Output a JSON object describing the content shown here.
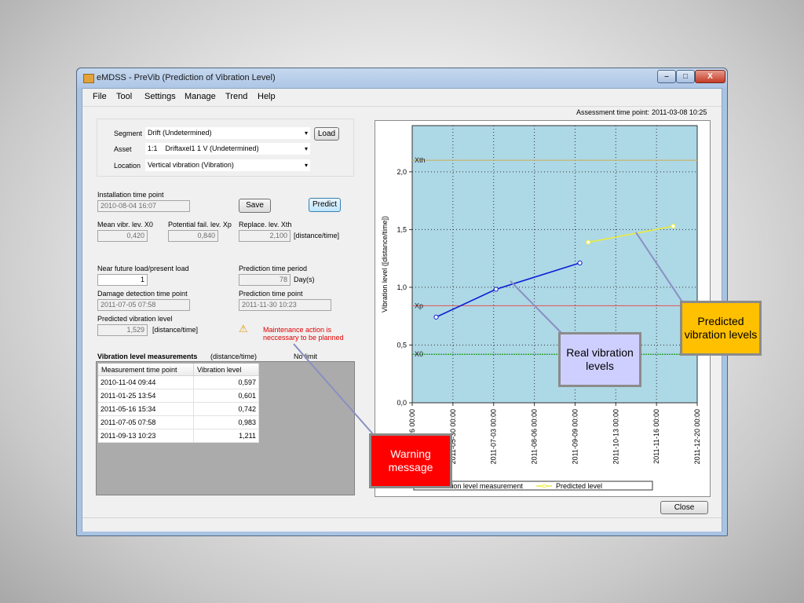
{
  "window": {
    "title": "eMDSS - PreVib (Prediction of Vibration Level)",
    "min": "–",
    "max": "□",
    "close": "X"
  },
  "menu": [
    "File",
    "Tool",
    "Settings",
    "Manage",
    "Trend",
    "Help"
  ],
  "assessment": {
    "label": "Assessment time point:",
    "value": "2011-03-08 10:25"
  },
  "segment": {
    "segment_label": "Segment",
    "segment_value": "Drift (Undetermined)",
    "asset_label": "Asset",
    "asset_value": "1:1    Driftaxel1 1 V (Undetermined)",
    "location_label": "Location",
    "location_value": "Vertical vibration (Vibration)",
    "load_button": "Load",
    "dropdown_glyph": "▾"
  },
  "form": {
    "installation_label": "Installation time point",
    "installation_value": "2010-08-04 16:07",
    "save_button": "Save",
    "predict_button": "Predict",
    "x0_label": "Mean vibr. lev. X0",
    "x0_value": "0,420",
    "xp_label": "Potential fail. lev. Xp",
    "xp_value": "0,840",
    "xth_label": "Replace. lev. Xth",
    "xth_value": "2,100",
    "unit": "[distance/time]",
    "load_label": "Near future load/present load",
    "load_value": "1",
    "period_label": "Prediction time period",
    "period_value": "78",
    "period_unit": "Day(s)",
    "damage_label": "Damage detection time point",
    "damage_value": "2011-07-05 07:58",
    "pred_point_label": "Prediction time point",
    "pred_point_value": "2011-11-30 10:23",
    "pred_level_label": "Predicted vibration level",
    "pred_level_value": "1,529",
    "pred_level_unit": "[distance/time]",
    "warning_icon": "⚠",
    "warning_text": "Maintenance action is neccessary to be planned"
  },
  "measurements": {
    "title": "Vibration level measurements",
    "unit": "(distance/time)",
    "nolimit": "No limit",
    "columns": [
      "Measurement time point",
      "Vibration level"
    ],
    "rows": [
      [
        "2010-11-04 09:44",
        "0,597"
      ],
      [
        "2011-01-25 13:54",
        "0,601"
      ],
      [
        "2011-05-16 15:34",
        "0,742"
      ],
      [
        "2011-07-05 07:58",
        "0,983"
      ],
      [
        "2011-09-13 10:23",
        "1,211"
      ]
    ]
  },
  "chart_data": {
    "type": "line",
    "ylabel": "Vibration level ([distance/time])",
    "ylim": [
      0,
      2.4
    ],
    "yticks": [
      {
        "v": 0,
        "label": "0,0"
      },
      {
        "v": 0.5,
        "label": "0,5"
      },
      {
        "v": 1.0,
        "label": "1,0"
      },
      {
        "v": 1.5,
        "label": "1,5"
      },
      {
        "v": 2.0,
        "label": "2,0"
      }
    ],
    "x_dates": [
      "2011-04-26",
      "2011-05-30",
      "2011-07-03",
      "2011-08-06",
      "2011-09-09",
      "2011-10-13",
      "2011-11-16",
      "2011-12-20"
    ],
    "x_ticklabels": [
      "2011-04-26 00:00",
      "2011-05-30 00:00",
      "2011-07-03 00:00",
      "2011-08-06 00:00",
      "2011-09-09 00:00",
      "2011-10-13 00:00",
      "2011-11-16 00:00",
      "2011-12-20 00:00"
    ],
    "xlim_dates": [
      "2011-04-26",
      "2011-12-20"
    ],
    "grid": true,
    "reference_lines": [
      {
        "name": "Xth",
        "value": 2.1,
        "color": "#c9b46e"
      },
      {
        "name": "Xp",
        "value": 0.84,
        "color": "#e06060"
      },
      {
        "name": "X0",
        "value": 0.42,
        "color": "#1a9a1a"
      }
    ],
    "series": [
      {
        "name": "Vibration level measurement",
        "color": "#0a1fd6",
        "x": [
          "2011-05-16",
          "2011-07-05",
          "2011-09-13"
        ],
        "y": [
          0.742,
          0.983,
          1.211
        ]
      },
      {
        "name": "Predicted level",
        "color": "#ecec3a",
        "x": [
          "2011-09-20",
          "2011-11-30"
        ],
        "y": [
          1.39,
          1.529
        ]
      }
    ],
    "legend": {
      "measurement": "Vibration level measurement",
      "predicted": "Predicted level"
    },
    "legend_position": "bottom"
  },
  "close_button": "Close",
  "callouts": {
    "warning": "Warning message",
    "real": "Real vibration levels",
    "predicted": "Predicted vibration levels"
  },
  "colors": {
    "plot_bg": "#add8e6",
    "accent": "#3c7fb1",
    "warning_text": "#e00000"
  }
}
